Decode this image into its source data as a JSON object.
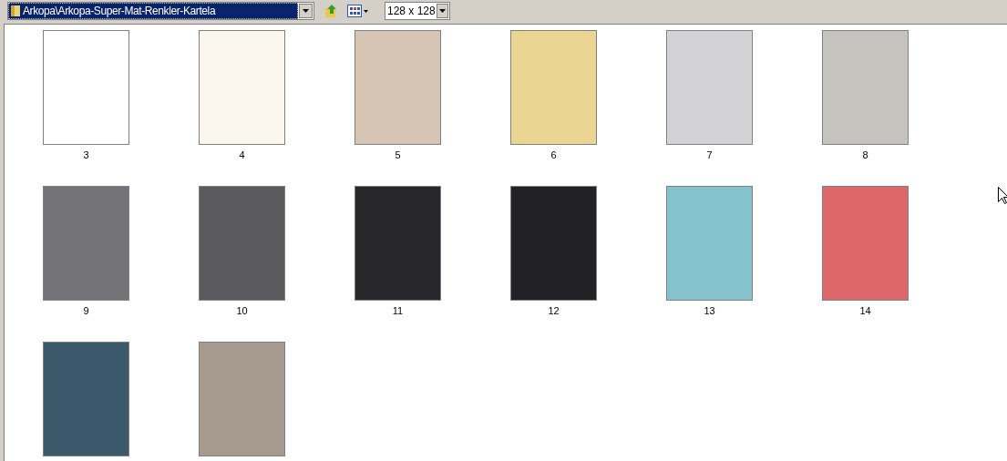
{
  "toolbar": {
    "path": "Arkopa\\Arkopa-Super-Mat-Renkler-Kartela",
    "size": "128 x 128"
  },
  "thumbnails": [
    {
      "label": "3",
      "color": "#ffffff"
    },
    {
      "label": "4",
      "color": "#fbf7ee"
    },
    {
      "label": "5",
      "color": "#d7c5b3"
    },
    {
      "label": "6",
      "color": "#ead593"
    },
    {
      "label": "7",
      "color": "#d3d3d5"
    },
    {
      "label": "8",
      "color": "#c4c3be"
    },
    {
      "label": "9",
      "color": "#747378"
    },
    {
      "label": "10",
      "color": "#5a5a5c"
    },
    {
      "label": "11",
      "color": "#28282a"
    },
    {
      "label": "12",
      "color": "#222224"
    },
    {
      "label": "13",
      "color": "#84c2cd"
    },
    {
      "label": "14",
      "color": "#de6869"
    },
    {
      "color": "#3a5a6c"
    },
    {
      "color": "#a49a8e"
    }
  ]
}
